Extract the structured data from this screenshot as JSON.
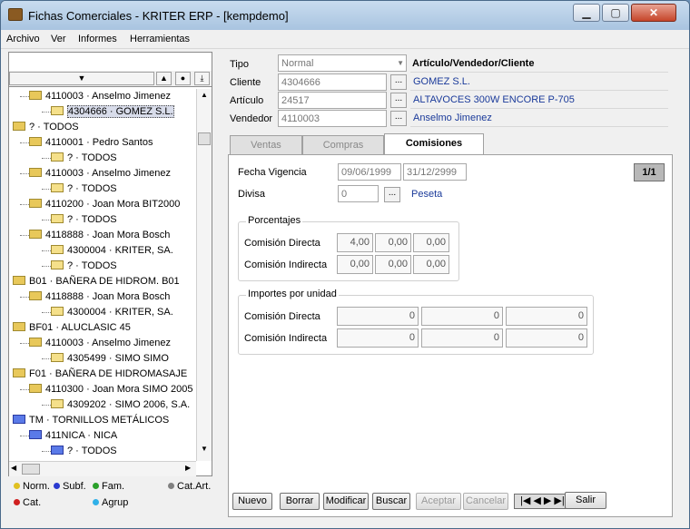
{
  "window": {
    "title": "Fichas Comerciales - KRITER ERP -  [kempdemo]"
  },
  "menu": [
    "Archivo",
    "Ver",
    "Informes",
    "Herramientas"
  ],
  "tree": [
    {
      "t": "4110003 · Anselmo Jimenez",
      "type": "node",
      "lvl": 1
    },
    {
      "t": "4304666 · GOMEZ S.L.",
      "type": "leaf",
      "lvl": 2,
      "sel": true
    },
    {
      "t": "? · TODOS",
      "type": "root",
      "lvl": 0
    },
    {
      "t": "4110001 · Pedro Santos",
      "type": "node",
      "lvl": 1
    },
    {
      "t": "? · TODOS",
      "type": "leaf",
      "lvl": 2
    },
    {
      "t": "4110003 · Anselmo Jimenez",
      "type": "node",
      "lvl": 1
    },
    {
      "t": "? · TODOS",
      "type": "leaf",
      "lvl": 2
    },
    {
      "t": "4110200 · Joan Mora BIT2000",
      "type": "node",
      "lvl": 1
    },
    {
      "t": "? · TODOS",
      "type": "leaf",
      "lvl": 2
    },
    {
      "t": "4118888 · Joan Mora Bosch",
      "type": "node",
      "lvl": 1
    },
    {
      "t": "4300004 · KRITER, SA.",
      "type": "leaf",
      "lvl": 2
    },
    {
      "t": "? · TODOS",
      "type": "leaf",
      "lvl": 2
    },
    {
      "t": "B01 · BAÑERA DE HIDROM. B01",
      "type": "root",
      "lvl": 0
    },
    {
      "t": "4118888 · Joan Mora Bosch",
      "type": "node",
      "lvl": 1
    },
    {
      "t": "4300004 · KRITER, SA.",
      "type": "leaf",
      "lvl": 2
    },
    {
      "t": "BF01 · ALUCLASIC 45",
      "type": "root",
      "lvl": 0
    },
    {
      "t": "4110003 · Anselmo Jimenez",
      "type": "node",
      "lvl": 1
    },
    {
      "t": "4305499 · SIMO SIMO",
      "type": "leaf",
      "lvl": 2
    },
    {
      "t": "F01 · BAÑERA DE HIDROMASAJE",
      "type": "root",
      "lvl": 0
    },
    {
      "t": "4110300 · Joan Mora SIMO 2005",
      "type": "node",
      "lvl": 1
    },
    {
      "t": "4309202 · SIMO 2006, S.A.",
      "type": "leaf",
      "lvl": 2
    },
    {
      "t": "TM · TORNILLOS METÁLICOS",
      "type": "root",
      "lvl": 0,
      "blue": true
    },
    {
      "t": "411NICA · NICA",
      "type": "node",
      "lvl": 1,
      "blue": true
    },
    {
      "t": "? · TODOS",
      "type": "leaf",
      "lvl": 2,
      "blue": true
    }
  ],
  "legend": {
    "norm": "Norm.",
    "subf": "Subf.",
    "fam": "Fam.",
    "catart": "Cat.Art.",
    "cat": "Cat.",
    "agrup": "Agrup",
    "colors": {
      "norm": "#e0c020",
      "subf": "#2a3ad0",
      "fam": "#2aa02a",
      "catart": "#808080",
      "cat": "#d02020",
      "agrup": "#30b0e8"
    }
  },
  "form": {
    "tipo_label": "Tipo",
    "tipo_value": "Normal",
    "cliente_label": "Cliente",
    "cliente_value": "4304666",
    "cliente_name": "GOMEZ S.L.",
    "articulo_label": "Artículo",
    "articulo_value": "24517",
    "articulo_name": "ALTAVOCES 300W ENCORE P-705",
    "vendedor_label": "Vendedor",
    "vendedor_value": "4110003",
    "vendedor_name": "Anselmo Jimenez",
    "header": "Artículo/Vendedor/Cliente"
  },
  "tabs": [
    "Ventas",
    "Compras",
    "Comisiones"
  ],
  "panel": {
    "fecha_label": "Fecha Vigencia",
    "fecha_desde": "09/06/1999",
    "fecha_hasta": "31/12/2999",
    "page": "1/1",
    "divisa_label": "Divisa",
    "divisa_value": "0",
    "divisa_name": "Peseta",
    "porc_title": "Porcentajes",
    "directa_label": "Comisión Directa",
    "indirecta_label": "Comisión Indirecta",
    "porc_directa": [
      "4,00",
      "0,00",
      "0,00"
    ],
    "porc_indirecta": [
      "0,00",
      "0,00",
      "0,00"
    ],
    "imp_title": "Importes por unidad",
    "imp_directa": [
      "0",
      "0",
      "0"
    ],
    "imp_indirecta": [
      "0",
      "0",
      "0"
    ]
  },
  "buttons": {
    "nuevo": "Nuevo",
    "borrar": "Borrar",
    "modificar": "Modificar",
    "buscar": "Buscar",
    "aceptar": "Aceptar",
    "cancelar": "Cancelar",
    "salir": "Salir",
    "pager": "|◀ ◀ ▶ ▶|"
  }
}
